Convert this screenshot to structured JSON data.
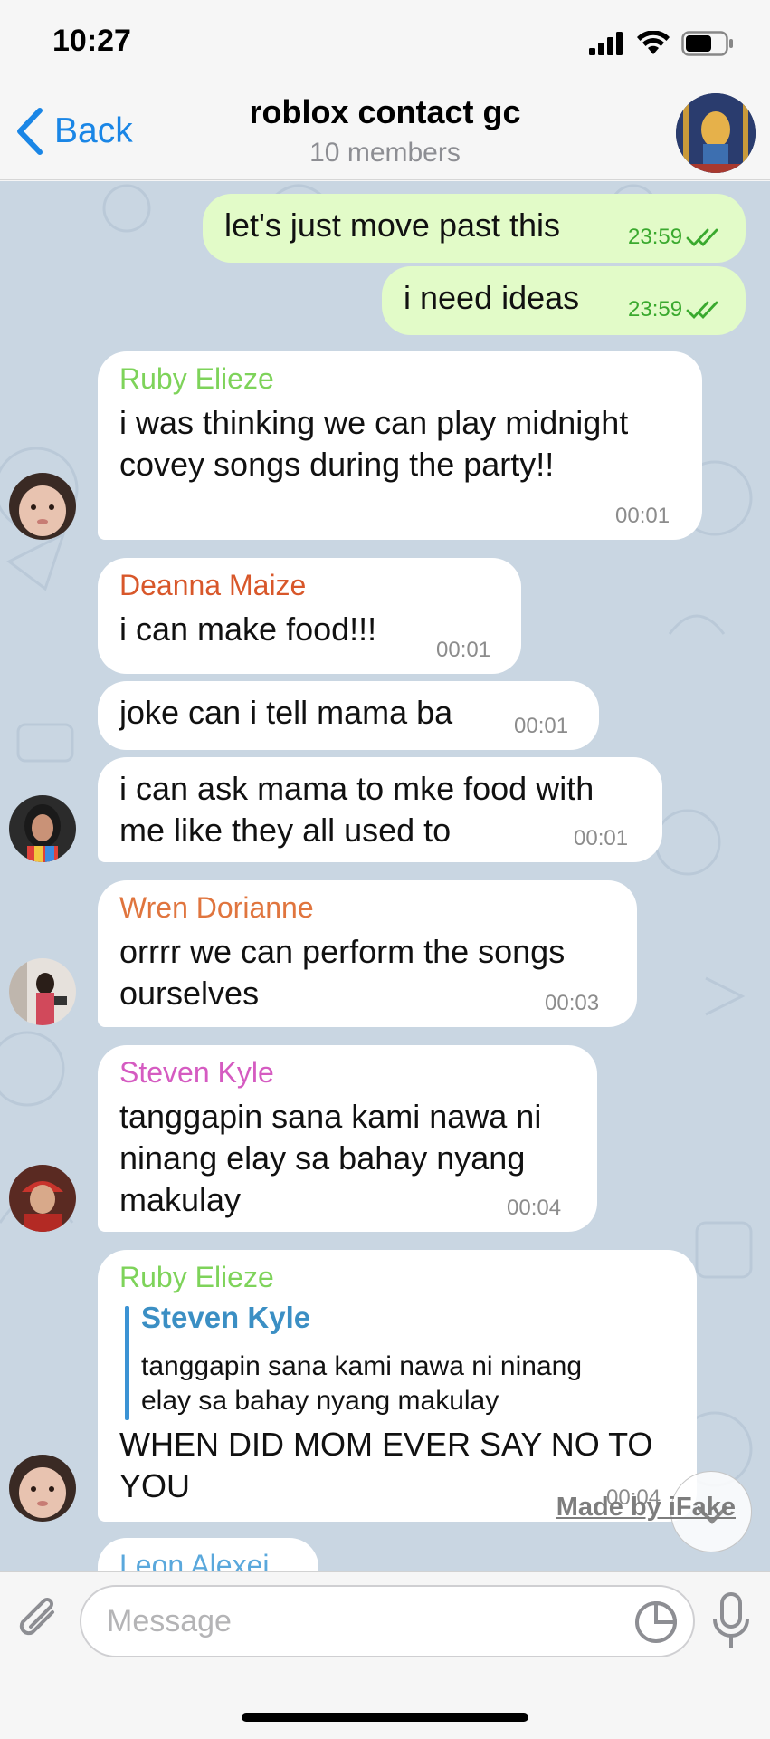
{
  "status": {
    "time": "10:27"
  },
  "header": {
    "back_label": "Back",
    "title": "roblox contact gc",
    "subtitle": "10 members"
  },
  "messages": [
    {
      "dir": "out",
      "text": "let's just move past this",
      "time": "23:59"
    },
    {
      "dir": "out",
      "text": "i need ideas",
      "time": "23:59"
    },
    {
      "dir": "in",
      "sender": "Ruby Elieze",
      "text": "i was thinking we can play midnight\ncovey songs during the party!!",
      "time": "00:01"
    },
    {
      "dir": "in",
      "sender": "Deanna Maize",
      "text": "i can make food!!!",
      "time": "00:01"
    },
    {
      "dir": "in",
      "text": "joke can i tell mama ba",
      "time": "00:01"
    },
    {
      "dir": "in",
      "text": "i can ask mama to mke food with\nme like they all used to",
      "time": "00:01"
    },
    {
      "dir": "in",
      "sender": "Wren Dorianne",
      "text": "orrrr we can perform the songs\nourselves",
      "time": "00:03"
    },
    {
      "dir": "in",
      "sender": "Steven Kyle",
      "text": "tanggapin sana kami nawa ni\nninang elay sa bahay nyang\nmakulay",
      "time": "00:04"
    },
    {
      "dir": "in",
      "sender": "Ruby Elieze",
      "reply_name": "Steven Kyle",
      "reply_text": "tanggapin sana kami nawa ni ninang\nelay sa bahay nyang makulay",
      "text": "WHEN DID MOM EVER SAY NO TO\nYOU",
      "time": "00:04"
    },
    {
      "dir": "in",
      "sender": "Leon Alexei"
    }
  ],
  "colors": {
    "ruby": "#7ed35a",
    "deanna": "#d8572a",
    "wren": "#e0753e",
    "steven": "#d55bc1",
    "leon": "#5aa8dc"
  },
  "watermark": "Made by iFake",
  "input": {
    "placeholder": "Message"
  }
}
